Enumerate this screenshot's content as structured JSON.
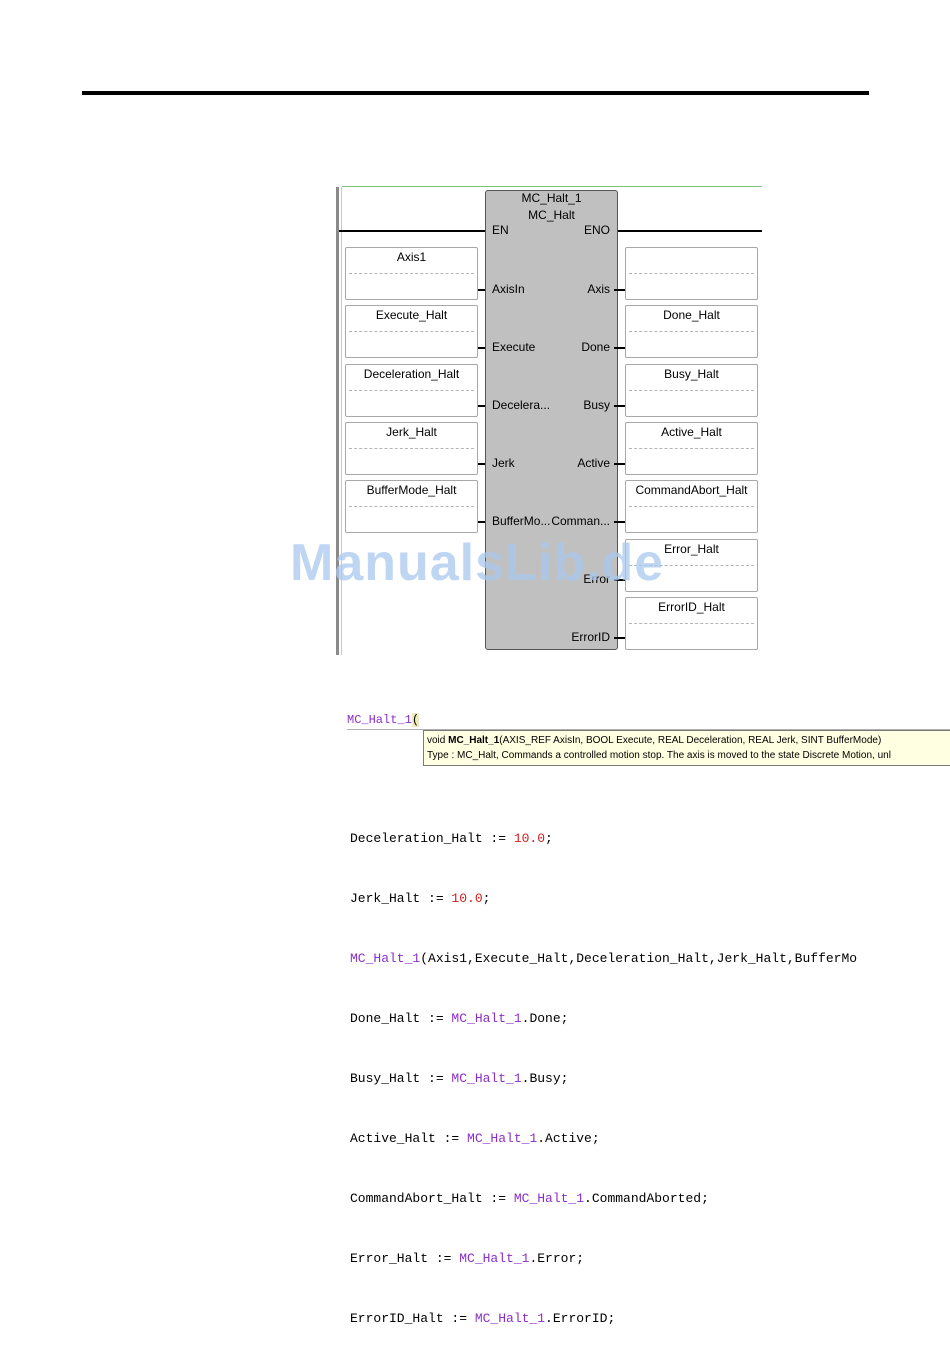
{
  "block": {
    "instance": "MC_Halt_1",
    "type": "MC_Halt",
    "inputs": [
      "EN",
      "AxisIn",
      "Execute",
      "Decelera...",
      "Jerk",
      "BufferMo..."
    ],
    "outputs": [
      "ENO",
      "Axis",
      "Done",
      "Busy",
      "Active",
      "Comman...",
      "Error",
      "ErrorID"
    ]
  },
  "input_vars": [
    "Axis1",
    "Execute_Halt",
    "Deceleration_Halt",
    "Jerk_Halt",
    "BufferMode_Halt"
  ],
  "output_vars": [
    "",
    "Done_Halt",
    "Busy_Halt",
    "Active_Halt",
    "CommandAbort_Halt",
    "Error_Halt",
    "ErrorID_Halt"
  ],
  "watermark": "ManualsLib.de",
  "editor": {
    "typed_text": "MC_Halt_1",
    "typed_paren": "(",
    "tooltip_line1_prefix": "void ",
    "tooltip_line1_name": "MC_Halt_1",
    "tooltip_line1_rest": "(AXIS_REF AxisIn, BOOL Execute, REAL Deceleration, REAL Jerk, SINT BufferMode)",
    "tooltip_line2": "Type : MC_Halt, Commands a controlled motion stop. The axis is moved to the state Discrete Motion, unl"
  },
  "code": {
    "l1_a": "Deceleration_Halt := ",
    "l1_num": "10.0",
    "l1_b": ";",
    "l2_a": "Jerk_Halt := ",
    "l2_num": "10.0",
    "l2_b": ";",
    "l3_id": "MC_Halt_1",
    "l3_b": "(Axis1,Execute_Halt,Deceleration_Halt,Jerk_Halt,BufferMo",
    "l4_a": "Done_Halt := ",
    "l4_id": "MC_Halt_1",
    "l4_b": ".Done;",
    "l5_a": "Busy_Halt := ",
    "l5_id": "MC_Halt_1",
    "l5_b": ".Busy;",
    "l6_a": "Active_Halt := ",
    "l6_id": "MC_Halt_1",
    "l6_b": ".Active;",
    "l7_a": "CommandAbort_Halt := ",
    "l7_id": "MC_Halt_1",
    "l7_b": ".CommandAborted;",
    "l8_a": "Error_Halt := ",
    "l8_id": "MC_Halt_1",
    "l8_b": ".Error;",
    "l9_a": "ErrorID_Halt := ",
    "l9_id": "MC_Halt_1",
    "l9_b": ".ErrorID;"
  }
}
